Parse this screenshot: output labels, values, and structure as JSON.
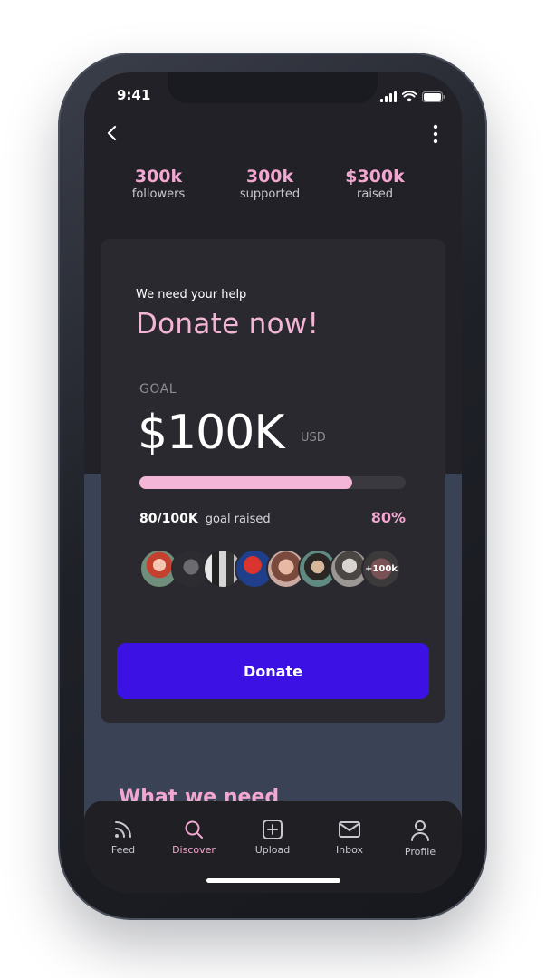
{
  "status_bar": {
    "time": "9:41",
    "icons": [
      "signal-icon",
      "wifi-icon",
      "battery-icon"
    ]
  },
  "nav": {
    "back_icon": "chevron-left-icon",
    "more_icon": "more-vertical-icon"
  },
  "stats": [
    {
      "value": "300k",
      "label": "followers"
    },
    {
      "value": "300k",
      "label": "supported"
    },
    {
      "value": "$300k",
      "label": "raised"
    }
  ],
  "card": {
    "kicker": "We need your help",
    "headline": "Donate now!",
    "goal_label": "GOAL",
    "goal_amount": "$100K",
    "goal_unit": "USD",
    "progress_fraction": 0.8,
    "raised_amount": "80/100K",
    "raised_label": "goal raised",
    "raised_percent": "80%",
    "supporters_more": "+100k",
    "donate_label": "Donate"
  },
  "section": {
    "title": "What we need"
  },
  "tabbar": {
    "tabs": [
      {
        "label": "Feed",
        "icon": "feed-icon"
      },
      {
        "label": "Discover",
        "icon": "search-icon",
        "active": true
      },
      {
        "label": "Upload",
        "icon": "plus-square-icon"
      },
      {
        "label": "Inbox",
        "icon": "mail-icon"
      },
      {
        "label": "Profile",
        "icon": "user-icon"
      }
    ]
  },
  "colors": {
    "accent_pink": "#f4b6d7",
    "button_blue": "#3b12e3",
    "screen_bg": "#222127",
    "card_bg": "#2a292f",
    "lower_bg": "#3a4256"
  }
}
